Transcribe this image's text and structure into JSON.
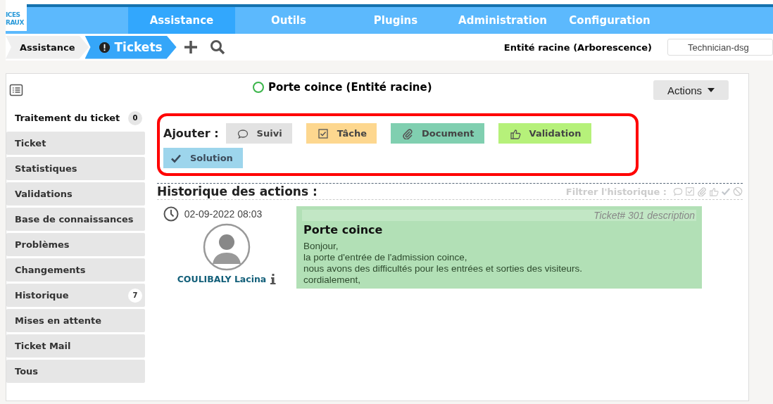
{
  "logo": {
    "lines": [
      "ICES",
      "RAUX"
    ]
  },
  "menu": [
    {
      "label": "Assistance",
      "selected": true
    },
    {
      "label": "Outils",
      "selected": false
    },
    {
      "label": "Plugins",
      "selected": false
    },
    {
      "label": "Administration",
      "selected": false
    },
    {
      "label": "Configuration",
      "selected": false
    }
  ],
  "breadcrumb": [
    {
      "label": "Assistance",
      "selected": false
    },
    {
      "label": "Tickets",
      "selected": true
    }
  ],
  "entity": {
    "label": "Entité racine (Arborescence)",
    "profile": "Technician-dsg"
  },
  "ticket": {
    "title": "Porte coince (Entité racine)",
    "actions": "Actions"
  },
  "sidebar": [
    {
      "label": "Traitement du ticket",
      "selected": true,
      "badge": "0"
    },
    {
      "label": "Ticket",
      "selected": false
    },
    {
      "label": "Statistiques",
      "selected": false
    },
    {
      "label": "Validations",
      "selected": false
    },
    {
      "label": "Base de connaissances",
      "selected": false
    },
    {
      "label": "Problèmes",
      "selected": false
    },
    {
      "label": "Changements",
      "selected": false
    },
    {
      "label": "Historique",
      "selected": false,
      "badge": "7"
    },
    {
      "label": "Mises en attente",
      "selected": false
    },
    {
      "label": "Ticket Mail",
      "selected": false
    },
    {
      "label": "Tous",
      "selected": false
    }
  ],
  "add": {
    "label": "Ajouter :",
    "buttons": [
      {
        "kind": "followup",
        "label": "Suivi",
        "color": "#e2e2e2"
      },
      {
        "kind": "task",
        "label": "Tâche",
        "color": "#fdd78f"
      },
      {
        "kind": "document",
        "label": "Document",
        "color": "#80cfb0"
      },
      {
        "kind": "validation",
        "label": "Validation",
        "color": "#b6f17a"
      },
      {
        "kind": "solution",
        "label": "Solution",
        "color": "#9dd5ec"
      }
    ]
  },
  "history": {
    "title": "Historique des actions :",
    "filter_label": "Filtrer l'historique :",
    "entries": [
      {
        "date": "02-09-2022 08:03",
        "author": "COULIBALY Lacina",
        "header": "Ticket# 301 description",
        "title": "Porte coince",
        "lines": [
          "Bonjour,",
          "la porte d'entrée de l'admission coince,",
          "nous avons des difficultés pour les entrées et sorties des visiteurs.",
          "cordialement,"
        ]
      }
    ]
  }
}
